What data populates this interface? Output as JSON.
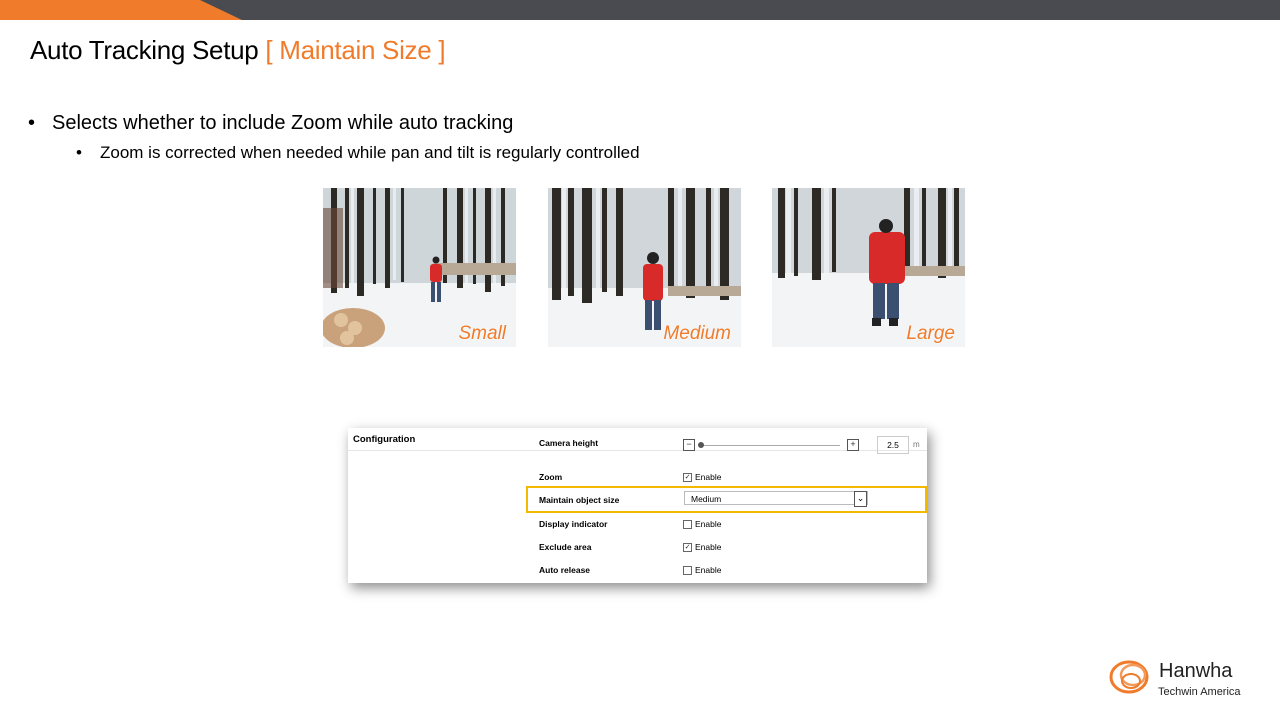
{
  "slide": {
    "title": "Auto Tracking Setup",
    "title_accent": "[ Maintain Size ]",
    "bullet_1": "Selects whether to include Zoom while auto tracking",
    "bullet_2": "Zoom is corrected when needed while pan and tilt is regularly controlled",
    "bullet_marker": "•"
  },
  "photos": [
    {
      "caption": "Small"
    },
    {
      "caption": "Medium"
    },
    {
      "caption": "Large"
    }
  ],
  "panel": {
    "section_title": "Configuration",
    "camera_height": {
      "label": "Camera height",
      "value": "2.5",
      "unit": "m",
      "minus": "−",
      "plus": "+"
    },
    "zoom": {
      "label": "Zoom",
      "option": "Enable",
      "checked": true
    },
    "maintain_object_size": {
      "label": "Maintain object size",
      "selected": "Medium"
    },
    "display_indicator": {
      "label": "Display indicator",
      "option": "Enable",
      "checked": false
    },
    "exclude_area": {
      "label": "Exclude area",
      "option": "Enable",
      "checked": true
    },
    "auto_release": {
      "label": "Auto release",
      "option": "Enable",
      "checked": false
    }
  },
  "logo": {
    "brand": "Hanwha",
    "subtitle": "Techwin America"
  },
  "colors": {
    "accent": "#f07b2a",
    "topbar": "#4a4b50",
    "highlight": "#f5b800"
  },
  "icons": {
    "check": "✓",
    "dropdown": "⌄"
  }
}
